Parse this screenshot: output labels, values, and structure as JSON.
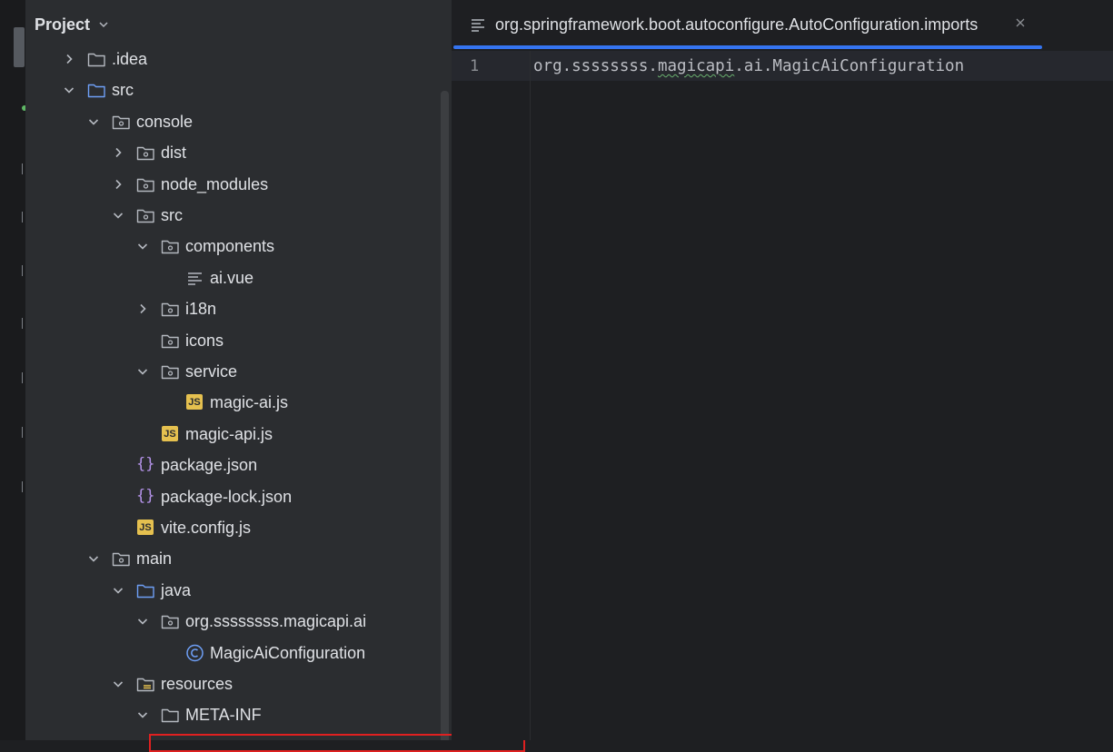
{
  "project_panel": {
    "title": "Project",
    "tree": [
      {
        "label": ".idea",
        "icon": "folder-icon",
        "expanded": false
      },
      {
        "label": "src",
        "icon": "source-folder-icon",
        "expanded": true
      },
      {
        "label": "console",
        "icon": "module-folder-icon",
        "expanded": true
      },
      {
        "label": "dist",
        "icon": "module-folder-icon",
        "expanded": false
      },
      {
        "label": "node_modules",
        "icon": "module-folder-icon",
        "expanded": false
      },
      {
        "label": "src",
        "icon": "module-folder-icon",
        "expanded": true
      },
      {
        "label": "components",
        "icon": "module-folder-icon",
        "expanded": true
      },
      {
        "label": "ai.vue",
        "icon": "text-file-icon"
      },
      {
        "label": "i18n",
        "icon": "module-folder-icon",
        "expanded": false
      },
      {
        "label": "icons",
        "icon": "module-folder-icon"
      },
      {
        "label": "service",
        "icon": "module-folder-icon",
        "expanded": true
      },
      {
        "label": "magic-ai.js",
        "icon": "javascript-file-icon",
        "badge": "JS"
      },
      {
        "label": "magic-api.js",
        "icon": "javascript-file-icon",
        "badge": "JS"
      },
      {
        "label": "package.json",
        "icon": "json-file-icon",
        "glyph": "{}"
      },
      {
        "label": "package-lock.json",
        "icon": "json-file-icon",
        "glyph": "{}"
      },
      {
        "label": "vite.config.js",
        "icon": "javascript-file-icon",
        "badge": "JS"
      },
      {
        "label": "main",
        "icon": "module-folder-icon",
        "expanded": true
      },
      {
        "label": "java",
        "icon": "source-folder-icon",
        "expanded": true
      },
      {
        "label": "org.ssssssss.magicapi.ai",
        "icon": "package-icon",
        "expanded": true
      },
      {
        "label": "MagicAiConfiguration",
        "icon": "java-class-icon"
      },
      {
        "label": "resources",
        "icon": "resources-folder-icon",
        "expanded": true
      },
      {
        "label": "META-INF",
        "icon": "folder-icon",
        "expanded": true
      }
    ]
  },
  "editor": {
    "tab": {
      "label": "org.springframework.boot.autoconfigure.AutoConfiguration.imports"
    },
    "lines": [
      {
        "number": "1",
        "code": "org.ssssssss.magicapi.ai.MagicAiConfiguration"
      }
    ]
  },
  "colors": {
    "accent": "#3574f0",
    "highlight_box": "#e02020",
    "js_badge": "#e5c04f"
  }
}
